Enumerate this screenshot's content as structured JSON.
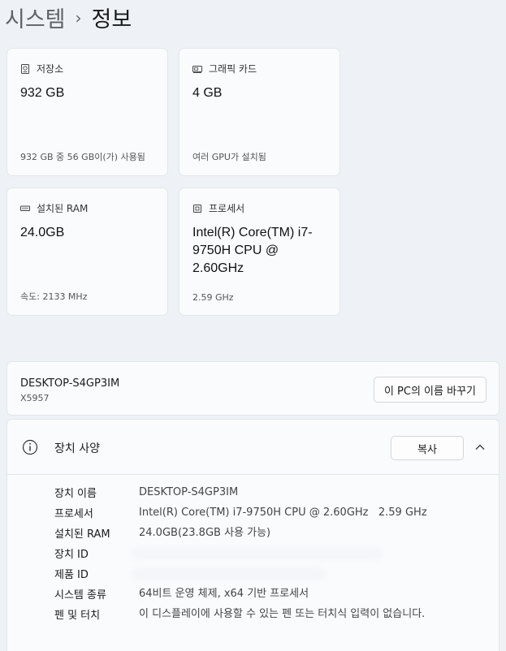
{
  "breadcrumb": {
    "parent": "시스템",
    "separator": "›",
    "current": "정보"
  },
  "cards": {
    "storage": {
      "label": "저장소",
      "value": "932 GB",
      "sub": "932 GB 중 56 GB이(가) 사용됨",
      "icon": "storage-icon"
    },
    "graphics": {
      "label": "그래픽 카드",
      "value": "4 GB",
      "sub": "여러 GPU가 설치됨",
      "icon": "graphics-card-icon"
    },
    "ram": {
      "label": "설치된 RAM",
      "value": "24.0GB",
      "sub": "속도: 2133 MHz",
      "icon": "ram-icon"
    },
    "processor": {
      "label": "프로세서",
      "value": "Intel(R) Core(TM) i7-9750H CPU @ 2.60GHz",
      "sub": "2.59 GHz",
      "icon": "processor-icon"
    }
  },
  "device": {
    "name": "DESKTOP-S4GP3IM",
    "model": "X5957",
    "rename_label": "이 PC의 이름 바꾸기"
  },
  "specs": {
    "title": "장치 사양",
    "copy_label": "복사",
    "rows": [
      {
        "label": "장치 이름",
        "value": "DESKTOP-S4GP3IM"
      },
      {
        "label": "프로세서",
        "value": "Intel(R) Core(TM) i7-9750H CPU @ 2.60GHz   2.59 GHz"
      },
      {
        "label": "설치된 RAM",
        "value": "24.0GB(23.8GB 사용 가능)"
      },
      {
        "label": "장치 ID",
        "value": ""
      },
      {
        "label": "제품 ID",
        "value": ""
      },
      {
        "label": "시스템 종류",
        "value": "64비트 운영 체제, x64 기반 프로세서"
      },
      {
        "label": "펜 및 터치",
        "value": "이 디스플레이에 사용할 수 있는 펜 또는 터치식 입력이 없습니다."
      }
    ]
  }
}
